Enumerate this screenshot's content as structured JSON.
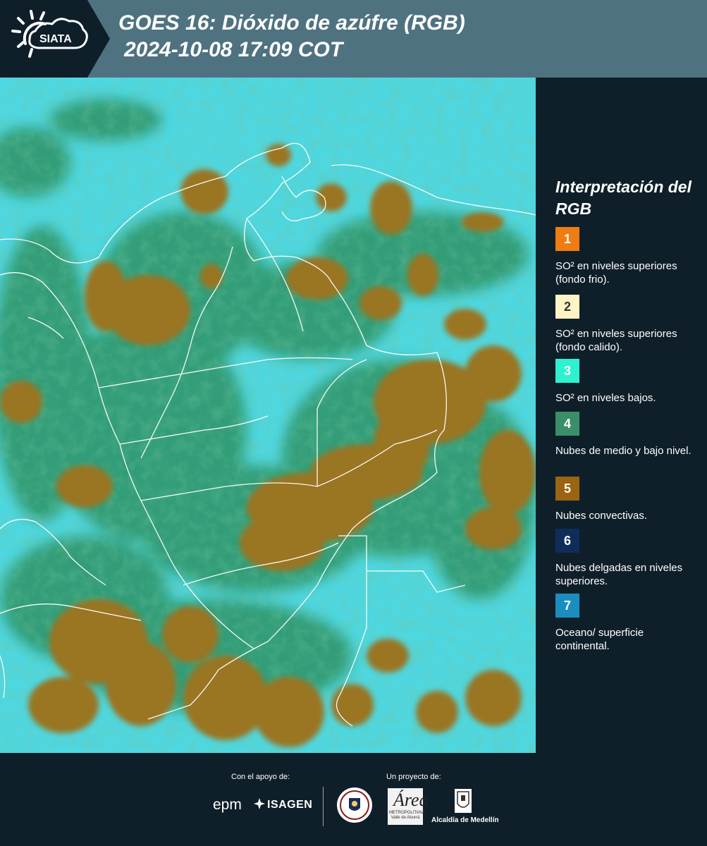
{
  "header": {
    "logo_text": "SIATA",
    "title_line1": "GOES 16: Dióxido de azúfre (RGB)",
    "title_line2": "2024-10-08 17:09 COT",
    "background_color": "#4f7281",
    "logo_band_color": "#0f1f2a"
  },
  "map": {
    "product": "GOES 16 SO2 RGB",
    "colors": {
      "ocean_surface": "#3fd2dc",
      "low_mid_clouds": "#2e8f5e",
      "convective_clouds": "#9a7420",
      "borders": "#ffffff"
    }
  },
  "legend": {
    "title": "Interpretación del RGB",
    "items": [
      {
        "number": "1",
        "color": "#f07d12",
        "text_color": "#ffffff",
        "label": "SO² en niveles superiores (fondo frio)."
      },
      {
        "number": "2",
        "color": "#fff5c4",
        "text_color": "#333333",
        "label": "SO² en niveles superiores (fondo calido)."
      },
      {
        "number": "3",
        "color": "#2ef2cf",
        "text_color": "#ffffff",
        "label": "SO² en niveles bajos."
      },
      {
        "number": "4",
        "color": "#3a8f6a",
        "text_color": "#ffffff",
        "label": "Nubes de medio y bajo nivel."
      },
      {
        "number": "5",
        "color": "#9a6412",
        "text_color": "#ffffff",
        "label": "Nubes convectivas."
      },
      {
        "number": "6",
        "color": "#0f2d5a",
        "text_color": "#ffffff",
        "label": "Nubes delgadas en niveles superiores."
      },
      {
        "number": "7",
        "color": "#1a8fbf",
        "text_color": "#ffffff",
        "label": "Oceano/ superficie continental."
      }
    ]
  },
  "footer": {
    "support_label": "Con el apoyo de:",
    "project_label": "Un proyecto de:",
    "epm": "epm",
    "isagen": "ISAGEN",
    "amva_initial": "Área",
    "amva_text": "METROPOLITANA Valle de Aburrá",
    "alcaldia": "Alcaldía de Medellín"
  }
}
